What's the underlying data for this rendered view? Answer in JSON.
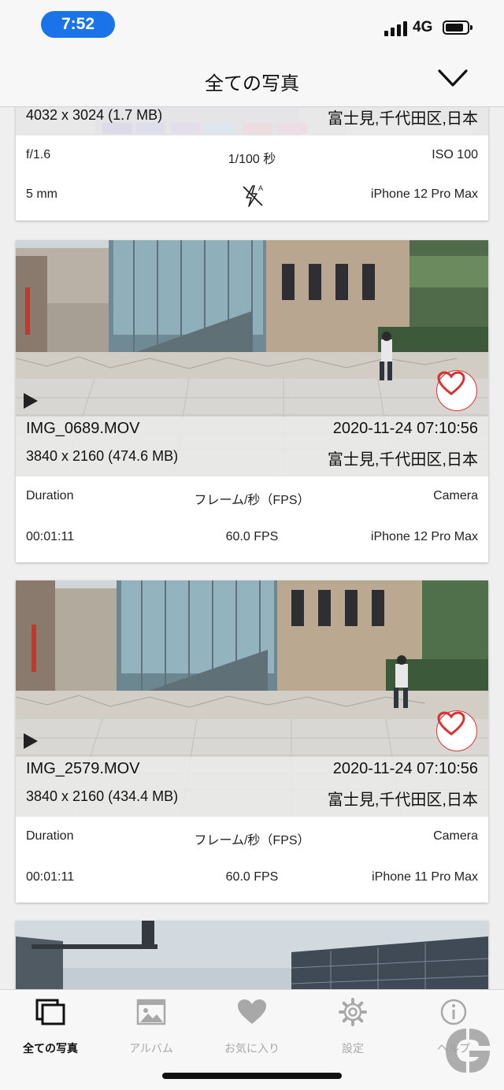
{
  "status_bar": {
    "time": "7:52",
    "network": "4G"
  },
  "header": {
    "title": "全ての写真"
  },
  "partial_card": {
    "resolution": "4032 x 3024 (1.7 MB)",
    "location": "富士見,千代田区,日本",
    "rows": [
      {
        "left": "f/1.6",
        "center": "1/100 秒",
        "right": "ISO 100"
      },
      {
        "left": "5 mm",
        "center_icon": "flash-auto-off-icon",
        "right": "iPhone 12 Pro Max"
      }
    ]
  },
  "cards": [
    {
      "filename": "IMG_0689.MOV",
      "datetime": "2020-11-24 07:10:56",
      "resolution": "3840 x 2160 (474.6 MB)",
      "location": "富士見,千代田区,日本",
      "header_row": {
        "left": "Duration",
        "center": "フレーム/秒（FPS）",
        "right": "Camera"
      },
      "value_row": {
        "left": "00:01:11",
        "center": "60.0 FPS",
        "right": "iPhone 12 Pro Max"
      }
    },
    {
      "filename": "IMG_2579.MOV",
      "datetime": "2020-11-24 07:10:56",
      "resolution": "3840 x 2160 (434.4 MB)",
      "location": "富士見,千代田区,日本",
      "header_row": {
        "left": "Duration",
        "center": "フレーム/秒（FPS）",
        "right": "Camera"
      },
      "value_row": {
        "left": "00:01:11",
        "center": "60.0 FPS",
        "right": "iPhone 11 Pro Max"
      }
    }
  ],
  "tabs": [
    {
      "label": "全ての写真",
      "icon": "photos-stack-icon",
      "active": true
    },
    {
      "label": "アルバム",
      "icon": "album-icon",
      "active": false
    },
    {
      "label": "お気に入り",
      "icon": "heart-icon",
      "active": false
    },
    {
      "label": "設定",
      "icon": "gear-icon",
      "active": false
    },
    {
      "label": "ヘルプ",
      "icon": "info-icon",
      "active": false
    }
  ],
  "colors": {
    "accent": "#1a73e8",
    "heart": "#d33333",
    "tab_active": "#111111",
    "tab_inactive": "#a8a8a8"
  }
}
